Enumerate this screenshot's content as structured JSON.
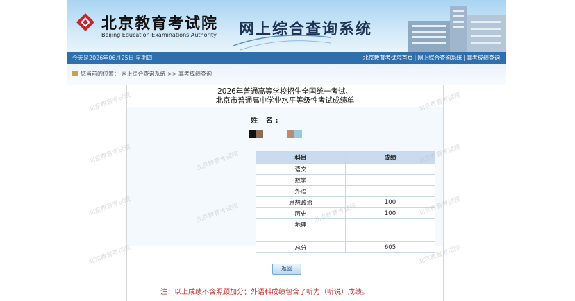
{
  "header": {
    "logo_cn": "北京教育考试院",
    "logo_en": "Beijing Education Examinations Authority",
    "system_title": "网上综合查询系统"
  },
  "navbar": {
    "date_text": "今天是2026年06月25日  星期四",
    "links": [
      "北京教育考试院首页",
      "网上综合查询系统",
      "高考成绩查询"
    ]
  },
  "breadcrumb": "您当前的位置：  网上综合查询系统 >> 高考成绩查询",
  "report": {
    "title_line1": "2026年普通高等学校招生全国统一考试、",
    "title_line2": "北京市普通高中学业水平等级性考试成绩单",
    "name_label": "姓  名:",
    "table": {
      "headers": [
        "科目",
        "成绩"
      ],
      "rows": [
        {
          "subject": "语文",
          "score": ""
        },
        {
          "subject": "数学",
          "score": ""
        },
        {
          "subject": "外语",
          "score": ""
        },
        {
          "subject": "思想政治",
          "score": "100"
        },
        {
          "subject": "历史",
          "score": "100"
        },
        {
          "subject": "地理",
          "score": ""
        },
        {
          "subject": "",
          "score": ""
        },
        {
          "subject": "总分",
          "score": "605"
        }
      ]
    },
    "back_button": "返回",
    "note": "注：以上成绩不含照顾加分；外语科成绩包含了听力（听说）成绩。"
  },
  "watermark_text": "北京教育考试院",
  "colors": {
    "navbar": "#2f6fad",
    "table_header": "#c9dbed",
    "note_red": "#c0302c"
  }
}
